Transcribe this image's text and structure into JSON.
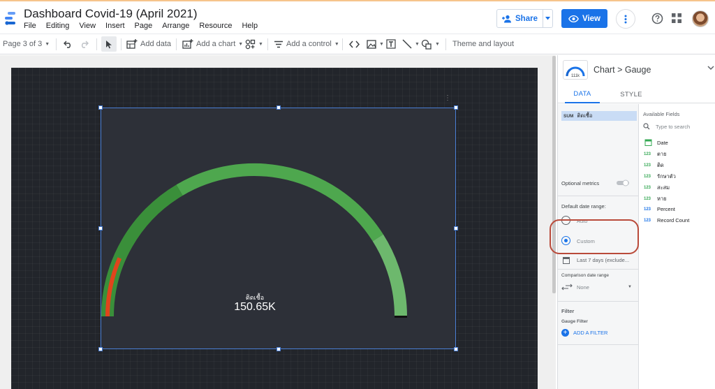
{
  "app": {
    "title": "Dashboard Covid-19 (April 2021)",
    "menu": [
      "File",
      "Editing",
      "View",
      "Insert",
      "Page",
      "Arrange",
      "Resource",
      "Help"
    ],
    "share_label": "Share",
    "view_label": "View"
  },
  "toolbar": {
    "page_indicator": "Page 3 of 3",
    "add_data": "Add data",
    "add_chart": "Add a chart",
    "add_control": "Add a control",
    "theme_layout": "Theme and layout"
  },
  "gauge": {
    "metric_label": "ติดเชื้อ",
    "value_text": "150.65K",
    "value_fraction": 0.12,
    "colors": {
      "band_dark": "#3a8f3a",
      "band_mid": "#4ea74e",
      "band_light": "#6db86d",
      "value_bar": "#e0441c"
    }
  },
  "panel": {
    "breadcrumb_chart": "Chart",
    "breadcrumb_sep": ">",
    "breadcrumb_type": "Gauge",
    "thumb_text": "111k",
    "tabs": {
      "data": "DATA",
      "style": "STYLE"
    },
    "metric": {
      "agg": "SUM",
      "name": "ติดเชื้อ"
    },
    "optional_metrics": "Optional metrics",
    "default_date_range": "Default date range:",
    "date_auto": "Auto",
    "date_custom": "Custom",
    "date_preset": "Last 7 days (exclude...",
    "comparison_label": "Comparison date range",
    "comparison_value": "None",
    "filter_title": "Filter",
    "gauge_filter": "Gauge Filter",
    "add_filter": "ADD A FILTER"
  },
  "available_fields": {
    "title": "Available Fields",
    "search_placeholder": "Type to search",
    "fields": [
      {
        "type": "date",
        "type_label": "",
        "name": "Date"
      },
      {
        "type": "number",
        "type_label": "123",
        "name": "ตาย"
      },
      {
        "type": "number",
        "type_label": "123",
        "name": "ติด"
      },
      {
        "type": "number",
        "type_label": "123",
        "name": "รักษาตัว"
      },
      {
        "type": "number",
        "type_label": "123",
        "name": "สะสม"
      },
      {
        "type": "number",
        "type_label": "123",
        "name": "หาย"
      },
      {
        "type": "calc",
        "type_label": "123",
        "name": "Percent"
      },
      {
        "type": "calc",
        "type_label": "123",
        "name": "Record Count"
      }
    ]
  }
}
